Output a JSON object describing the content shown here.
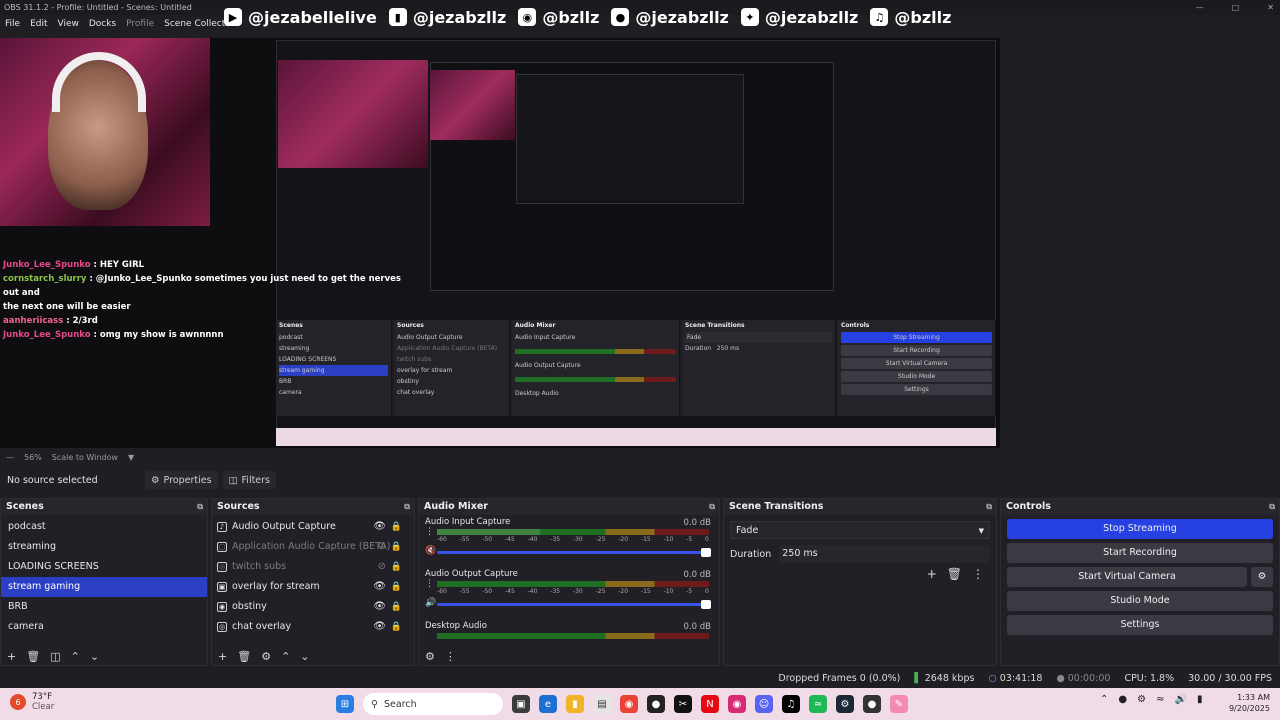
{
  "window": {
    "title": "OBS 31.1.2 - Profile: Untitled - Scenes: Untitled"
  },
  "menu": {
    "file": "File",
    "edit": "Edit",
    "view": "View",
    "docks": "Docks",
    "profile": "Profile",
    "scene_collection": "Scene Collection"
  },
  "banner": {
    "youtube": "@jezabellelive",
    "twitch": "@jezabzllz",
    "instagram": "@bzllz",
    "snapchat": "@jezabzllz",
    "twitter": "@jezabzllz",
    "tiktok": "@bzllz"
  },
  "chat": [
    {
      "user": "Junko_Lee_Spunko",
      "msg": ": HEY GIRL"
    },
    {
      "user": "cornstarch_slurry",
      "msg": ": @Junko_Lee_Spunko sometimes you just need to get the nerves out and"
    },
    {
      "user": "",
      "msg": "the next one will be easier"
    },
    {
      "user": "aanheriicass",
      "msg": ": 2/3rd"
    },
    {
      "user": "Junko_Lee_Spunko",
      "msg": ": omg my show is awnnnnn"
    }
  ],
  "zoom": {
    "value": "56%",
    "mode": "Scale to Window"
  },
  "properties_bar": {
    "no_source": "No source selected",
    "properties": "Properties",
    "filters": "Filters"
  },
  "scenes": {
    "title": "Scenes",
    "items": [
      "podcast",
      "streaming",
      "LOADING SCREENS",
      "stream gaming",
      "BRB",
      "camera"
    ],
    "selected": "stream gaming"
  },
  "sources": {
    "title": "Sources",
    "items": [
      {
        "label": "Audio Output Capture"
      },
      {
        "label": "Application Audio Capture (BETA)"
      },
      {
        "label": "twitch subs"
      },
      {
        "label": "overlay for stream"
      },
      {
        "label": "obstiny"
      },
      {
        "label": "chat overlay"
      }
    ]
  },
  "mixer": {
    "title": "Audio Mixer",
    "channels": [
      {
        "name": "Audio Input Capture",
        "db": "0.0 dB"
      },
      {
        "name": "Audio Output Capture",
        "db": "0.0 dB"
      },
      {
        "name": "Desktop Audio",
        "db": "0.0 dB"
      }
    ],
    "ticks": [
      "-60",
      "-55",
      "-50",
      "-45",
      "-40",
      "-35",
      "-30",
      "-25",
      "-20",
      "-15",
      "-10",
      "-5",
      "0"
    ]
  },
  "transitions": {
    "title": "Scene Transitions",
    "selected": "Fade",
    "duration_label": "Duration",
    "duration_value": "250 ms"
  },
  "controls": {
    "title": "Controls",
    "stop_streaming": "Stop Streaming",
    "start_recording": "Start Recording",
    "start_virtual_camera": "Start Virtual Camera",
    "studio_mode": "Studio Mode",
    "settings": "Settings"
  },
  "status": {
    "dropped": "Dropped Frames 0 (0.0%)",
    "bitrate": "2648 kbps",
    "stream_time": "03:41:18",
    "rec_time": "00:00:00",
    "cpu": "CPU: 1.8%",
    "fps": "30.00 / 30.00 FPS"
  },
  "taskbar": {
    "weather_temp": "73°F",
    "weather_desc": "Clear",
    "weather_badge": "6",
    "search": "Search",
    "time": "1:33 AM",
    "date": "9/20/2025"
  },
  "colors": {
    "accent": "#2640e2",
    "selected": "#2b3fc4",
    "taskbar": "#f1dbe6"
  }
}
